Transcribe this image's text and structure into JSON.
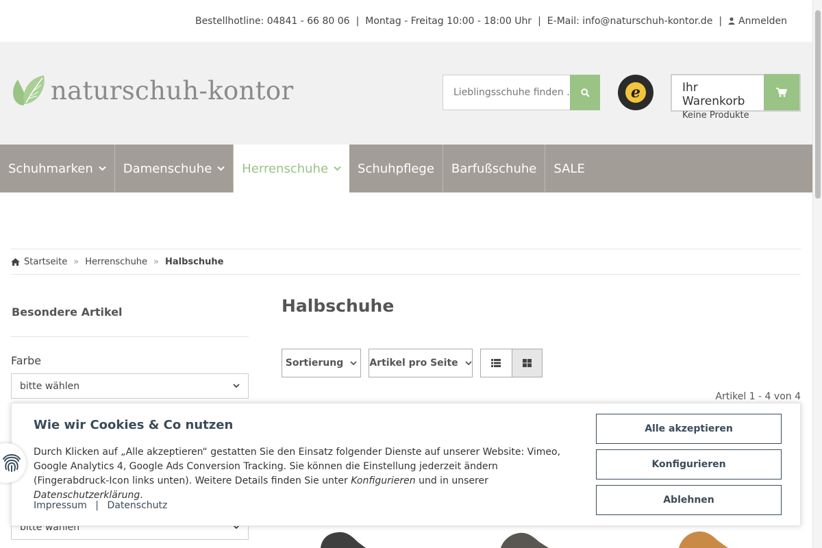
{
  "topbar": {
    "hotline": "Bestellhotline: 04841 - 66 80 06",
    "hours": "Montag - Freitag 10:00 - 18:00 Uhr",
    "email": "E-Mail: info@naturschuh-kontor.de",
    "login": "Anmelden",
    "separator": "|"
  },
  "header": {
    "logo_text": "naturschuh-kontor",
    "search_placeholder": "Lieblingsschuhe finden ...",
    "trust_badge": "TRUSTED SHOPS GUARANTEE",
    "trust_letter": "e",
    "cart_title": "Ihr Warenkorb",
    "cart_status": "Keine Produkte",
    "accent_color": "#9ac386"
  },
  "nav": {
    "items": [
      {
        "label": "Schuhmarken"
      },
      {
        "label": "Damenschuhe"
      },
      {
        "label": "Herrenschuhe"
      },
      {
        "label": "Schuhpflege"
      },
      {
        "label": "Barfußschuhe"
      },
      {
        "label": "SALE"
      }
    ],
    "active": "Herrenschuhe"
  },
  "breadcrumb": {
    "home": "Startseite",
    "level1": "Herrenschuhe",
    "current": "Halbschuhe",
    "separator": "»"
  },
  "sidebar": {
    "title": "Besondere Artikel",
    "filter_label": "Farbe",
    "select_value": "bitte wählen",
    "select2_value": "bitte wählen"
  },
  "main": {
    "title": "Halbschuhe",
    "sort_label": "Sortierung",
    "per_page_label": "Artikel pro Seite",
    "count_text": "Artikel 1 - 4 von 4"
  },
  "cookie": {
    "title": "Wie wir Cookies & Co nutzen",
    "text_1": "Durch Klicken auf „Alle akzeptieren“ gestatten Sie den Einsatz folgender Dienste auf unserer Website: Vimeo, Google Analytics 4, Google Ads Conversion Tracking. Sie können die Einstellung jederzeit ändern (Fingerabdruck-Icon links unten). Weitere Details finden Sie unter ",
    "text_link1": "Konfigurieren",
    "text_2": " und in unserer ",
    "text_link2": "Datenschutzerklärung",
    "text_3": ".",
    "link_impressum": "Impressum",
    "link_separator": "|",
    "link_datenschutz": "Datenschutz",
    "btn_accept": "Alle akzeptieren",
    "btn_configure": "Konfigurieren",
    "btn_decline": "Ablehnen",
    "text_color": "#3a4b5a"
  }
}
